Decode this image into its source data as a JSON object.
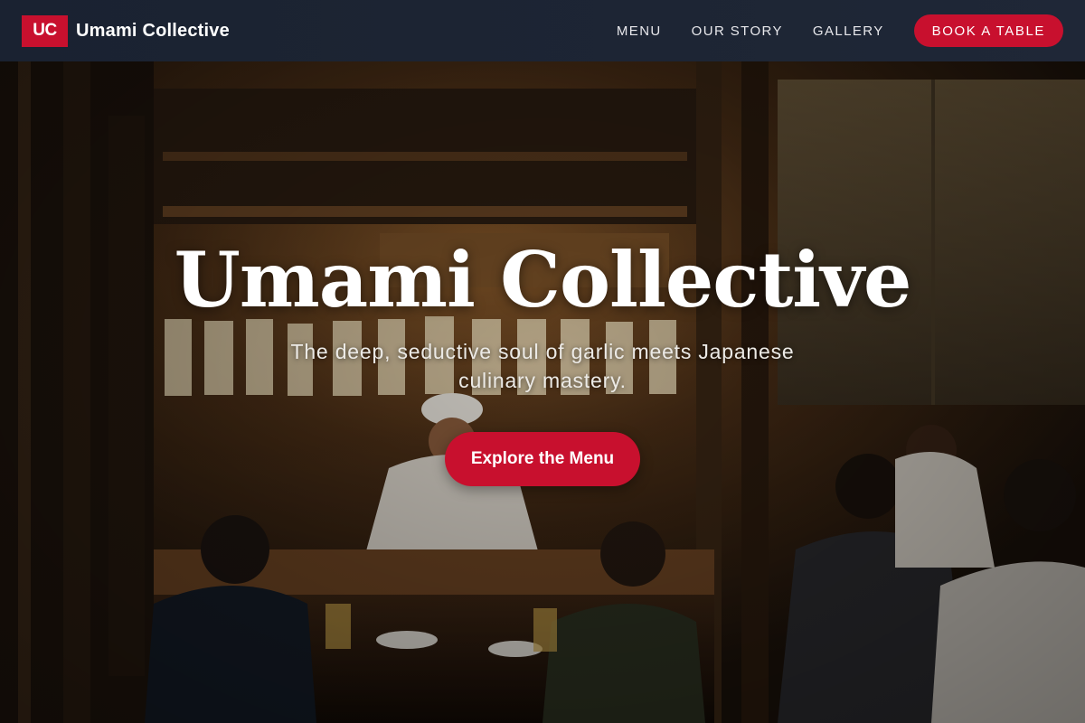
{
  "nav": {
    "logo_text": "UC",
    "brand_name": "Umami Collective",
    "links": [
      "MENU",
      "OUR STORY",
      "GALLERY"
    ],
    "cta_label": "BOOK A TABLE"
  },
  "hero": {
    "title": "Umami Collective",
    "subtitle": "The deep, seductive soul of garlic meets Japanese culinary mastery.",
    "button_label": "Explore the Menu",
    "background_description": "dim izakaya interior with a chef behind the counter and diners"
  },
  "colors": {
    "nav_bg": "#1c2433",
    "accent": "#c8102e",
    "text": "#ffffff"
  }
}
